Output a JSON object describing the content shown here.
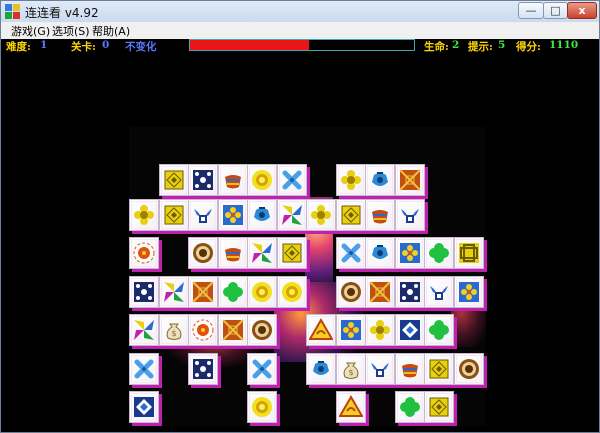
{
  "window": {
    "title": "连连看 v4.92",
    "controls": {
      "minimize": "—",
      "maximize": "□",
      "close": "x"
    }
  },
  "menu": [
    "游戏(G)",
    "选项(S)",
    "帮助(A)"
  ],
  "status": {
    "difficulty_label": "难度:",
    "difficulty_value": "1",
    "level_label": "关卡:",
    "level_value": "0",
    "mode_label": "不变化",
    "time_remaining_fraction": 0.53,
    "lives_label": "生命:",
    "lives_value": "2",
    "hints_label": "提示:",
    "hints_value": "5",
    "score_label": "得分:",
    "score_value": "1110"
  },
  "board": {
    "rows": [
      [
        null,
        "diamond-tile",
        "navy-dots-tile",
        "bowl-tile",
        "sun-tile",
        "cross-tile",
        null,
        "flower-tile",
        "pot-tile",
        "box-tile",
        null
      ],
      [
        "flower-tile",
        "diamond-tile",
        "winged-tile",
        "blue-flower-tile",
        "pot-tile",
        "pinwheel-tile",
        "flower-tile",
        "diamond-tile",
        "bowl-tile",
        "winged-tile",
        null
      ],
      [
        "medallion-tile",
        null,
        "ring-tile",
        "bowl-tile",
        "pinwheel-tile",
        "diamond-tile",
        null,
        "cross-tile",
        "pot-tile",
        "blue-flower-tile",
        "clover-tile",
        "knot-tile"
      ],
      [
        "navy-dots-tile",
        "pinwheel-tile",
        "box-tile",
        "clover-tile",
        "sun-tile",
        "sun-tile",
        null,
        "ring-tile",
        "box-tile",
        "navy-dots-tile",
        "winged-tile",
        "blue-flower-tile"
      ],
      [
        "pinwheel-tile",
        "money-bag-tile",
        "medallion-tile",
        "box-tile",
        "ring-tile",
        null,
        "warning-tile",
        "blue-flower-tile",
        "flower-tile",
        "frame-tile",
        "clover-tile",
        null
      ],
      [
        "cross-tile",
        null,
        "navy-dots-tile",
        null,
        "cross-tile",
        null,
        "pot-tile",
        "money-bag-tile",
        "winged-tile",
        "bowl-tile",
        "diamond-tile",
        "ring-tile"
      ],
      [
        "frame-tile",
        null,
        null,
        null,
        "sun-tile",
        null,
        null,
        "warning-tile",
        null,
        "clover-tile",
        "diamond-tile",
        null
      ]
    ]
  },
  "colors": {
    "tile_edge": "#c020b0",
    "timer": "#e81616",
    "label": "#ffd700",
    "value": "#5a79ff",
    "value_green": "#3ee83e"
  }
}
